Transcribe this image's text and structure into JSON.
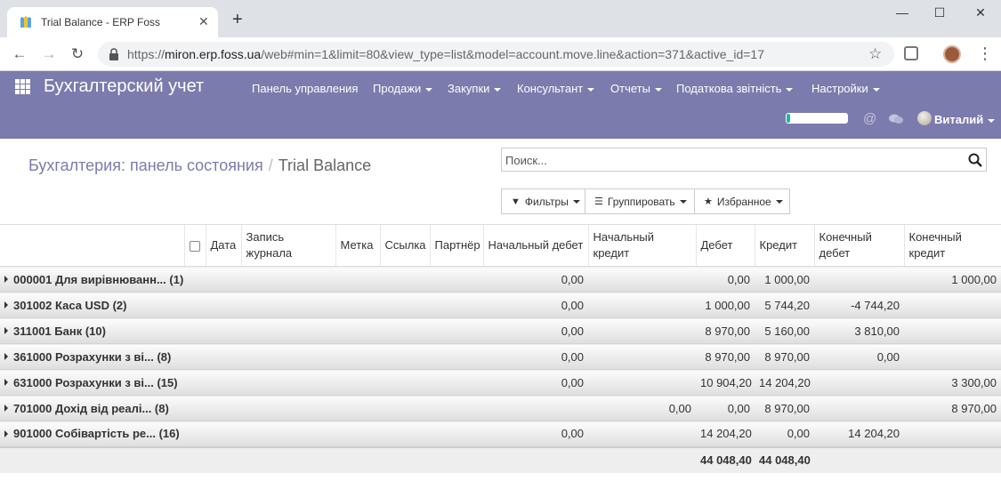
{
  "browser": {
    "tab_title": "Trial Balance - ERP Foss",
    "tab_close": "✕",
    "new_tab": "+",
    "window_min": "—",
    "window_max": "☐",
    "window_close": "✕",
    "url_scheme": "https://",
    "url_host": "miron.erp.foss.ua",
    "url_path": "/web#min=1&limit=80&view_type=list&model=account.move.line&action=371&active_id=17"
  },
  "app": {
    "brand": "Бухгалтерский учет",
    "menu": [
      {
        "label": "Панель управления",
        "dropdown": false
      },
      {
        "label": "Продажи",
        "dropdown": true
      },
      {
        "label": "Закупки",
        "dropdown": true
      },
      {
        "label": "Консультант",
        "dropdown": true
      },
      {
        "label": "Отчеты",
        "dropdown": true
      },
      {
        "label": "Податкова звітність",
        "dropdown": true
      },
      {
        "label": "Настройки",
        "dropdown": true
      }
    ],
    "user_name": "Виталий",
    "progress_fraction": 0.06,
    "accent": "#7c7bad"
  },
  "control_panel": {
    "breadcrumb_parent": "Бухгалтерия: панель состояния",
    "breadcrumb_separator": "/",
    "breadcrumb_current": "Trial Balance",
    "search_placeholder": "Поиск...",
    "filters_label": "Фильтры",
    "group_by_label": "Группировать",
    "favorites_label": "Избранное"
  },
  "table": {
    "headers": {
      "date": "Дата",
      "journal_entry": "Запись журнала",
      "label": "Метка",
      "reference": "Ссылка",
      "partner": "Партнёр",
      "initial_debit": "Начальный дебет",
      "initial_credit": "Начальный кредит",
      "debit": "Дебет",
      "credit": "Кредит",
      "final_debit": "Конечный дебет",
      "final_credit": "Конечный кредит"
    },
    "groups": [
      {
        "name": "000001 Для вирівнюванн... (1)",
        "initial_debit": "0,00",
        "initial_credit": "",
        "debit": "0,00",
        "credit": "1 000,00",
        "final_debit": "",
        "final_credit": "1 000,00"
      },
      {
        "name": "301002 Каса USD (2)",
        "initial_debit": "0,00",
        "initial_credit": "",
        "debit": "1 000,00",
        "credit": "5 744,20",
        "final_debit": "-4 744,20",
        "final_credit": ""
      },
      {
        "name": "311001 Банк (10)",
        "initial_debit": "0,00",
        "initial_credit": "",
        "debit": "8 970,00",
        "credit": "5 160,00",
        "final_debit": "3 810,00",
        "final_credit": ""
      },
      {
        "name": "361000 Розрахунки з ві... (8)",
        "initial_debit": "0,00",
        "initial_credit": "",
        "debit": "8 970,00",
        "credit": "8 970,00",
        "final_debit": "0,00",
        "final_credit": ""
      },
      {
        "name": "631000 Розрахунки з ві... (15)",
        "initial_debit": "0,00",
        "initial_credit": "",
        "debit": "10 904,20",
        "credit": "14 204,20",
        "final_debit": "",
        "final_credit": "3 300,00"
      },
      {
        "name": "701000 Дохід від реалі... (8)",
        "initial_debit": "",
        "initial_credit": "0,00",
        "debit": "0,00",
        "credit": "8 970,00",
        "final_debit": "",
        "final_credit": "8 970,00"
      },
      {
        "name": "901000 Собівартість ре... (16)",
        "initial_debit": "0,00",
        "initial_credit": "",
        "debit": "14 204,20",
        "credit": "0,00",
        "final_debit": "14 204,20",
        "final_credit": ""
      }
    ],
    "totals": {
      "debit": "44 048,40",
      "credit": "44 048,40"
    }
  }
}
